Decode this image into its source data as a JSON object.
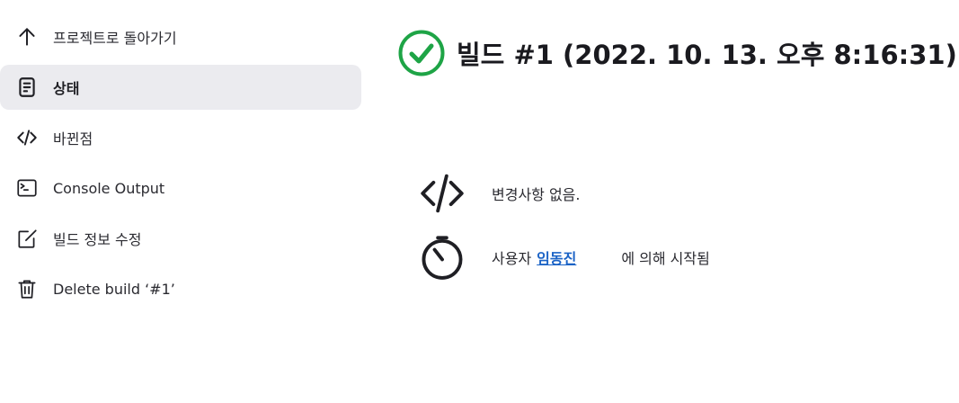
{
  "sidebar": {
    "items": [
      {
        "icon": "arrow-up-icon",
        "label": "프로젝트로 돌아가기",
        "active": false
      },
      {
        "icon": "document-icon",
        "label": "상태",
        "active": true
      },
      {
        "icon": "code-icon",
        "label": "바뀐점",
        "active": false
      },
      {
        "icon": "terminal-icon",
        "label": "Console Output",
        "active": false
      },
      {
        "icon": "edit-icon",
        "label": "빌드 정보 수정",
        "active": false
      },
      {
        "icon": "trash-icon",
        "label": "Delete build ‘#1’",
        "active": false
      }
    ]
  },
  "main": {
    "title": "빌드 #1 (2022. 10. 13. 오후 8:16:31)",
    "status_icon": "success-check-icon",
    "status_color": "#1ea446",
    "changes": {
      "icon": "code-icon",
      "text": "변경사항 없음."
    },
    "started_by": {
      "icon": "timer-icon",
      "prefix": "사용자",
      "user": "임동진",
      "suffix": "에 의해 시작됨"
    }
  },
  "colors": {
    "active_bg": "#ebebef",
    "link": "#1b63c6"
  }
}
